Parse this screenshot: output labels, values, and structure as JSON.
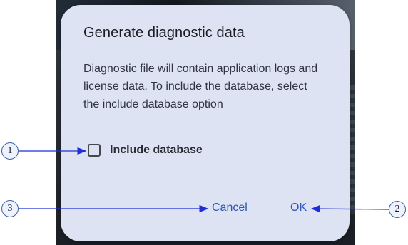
{
  "dialog": {
    "title": "Generate diagnostic data",
    "message": "Diagnostic file will contain application logs and license data. To include the database, select the include database option",
    "checkbox_label": "Include database",
    "checkbox_checked": false,
    "cancel_label": "Cancel",
    "ok_label": "OK"
  },
  "callouts": [
    "1",
    "2",
    "3"
  ],
  "colors": {
    "dialog_bg": "#dde3f2",
    "button_text": "#2c56b8",
    "callout_arrow": "#1d2ed8"
  }
}
